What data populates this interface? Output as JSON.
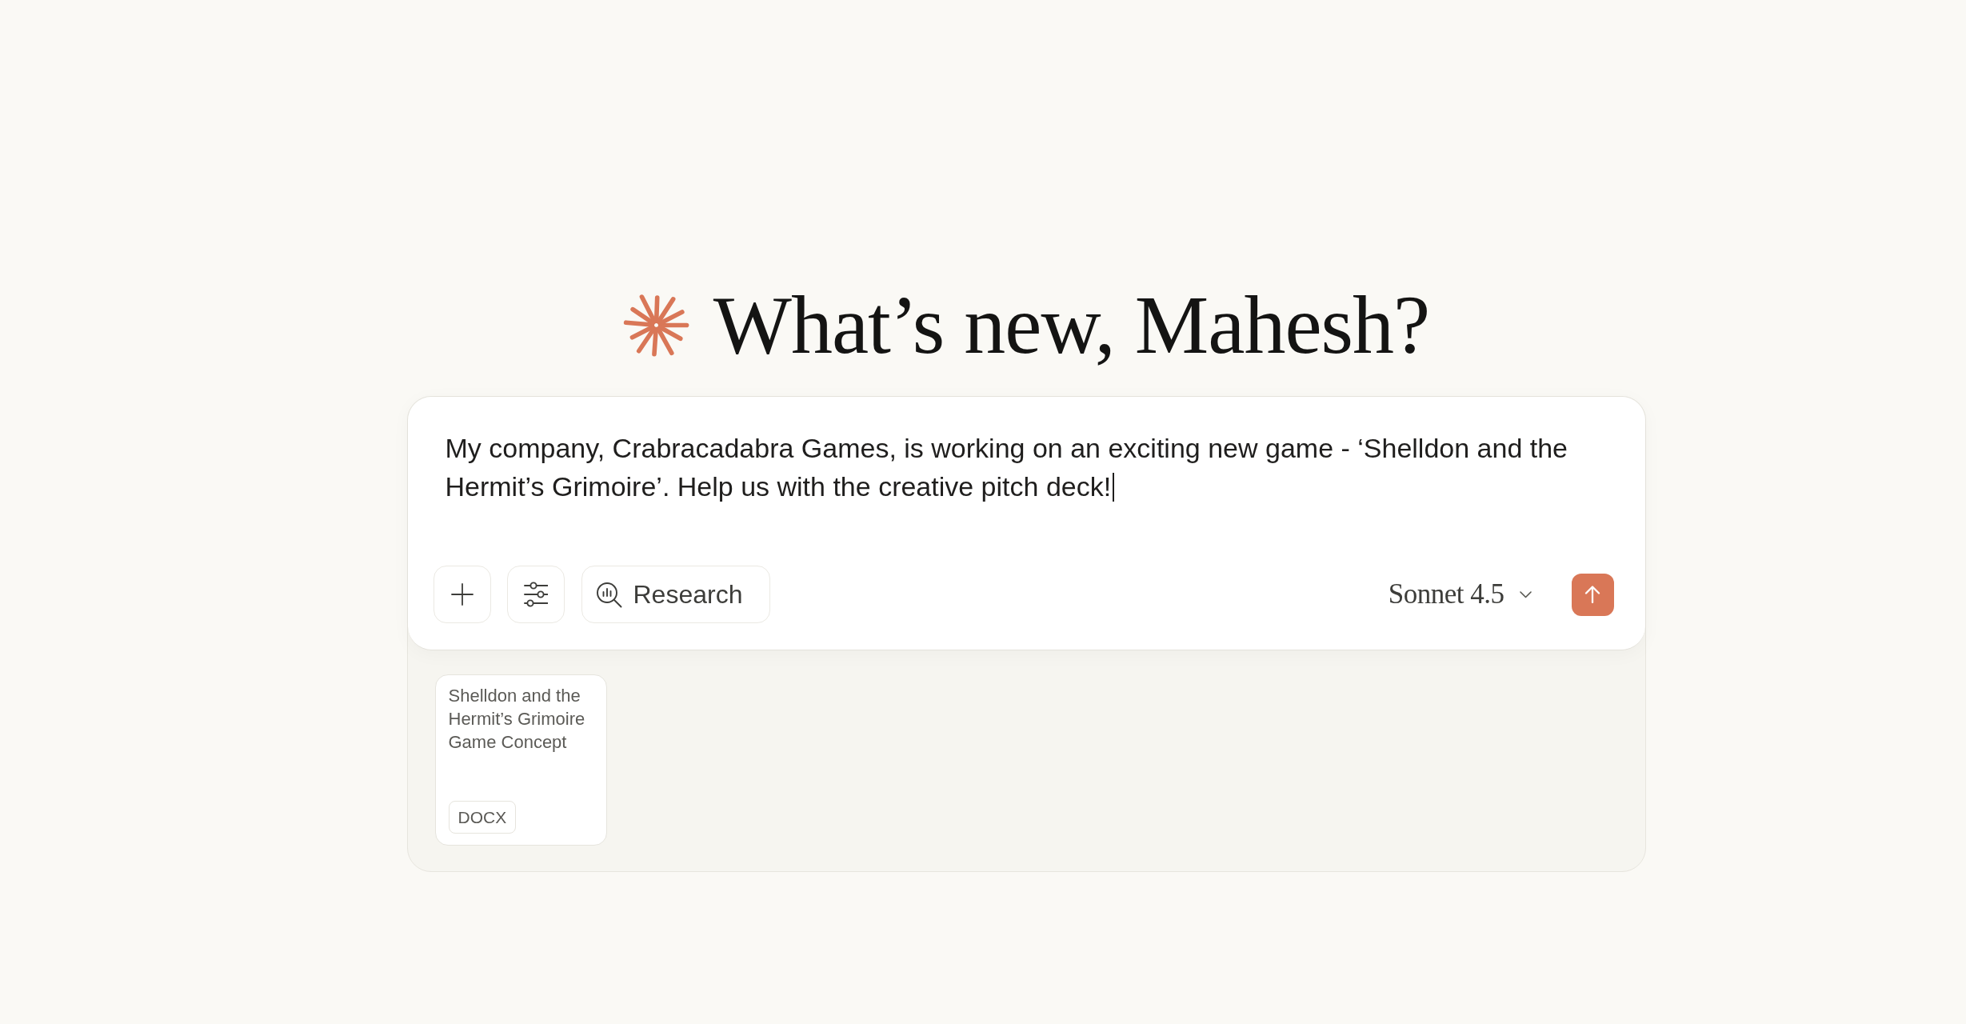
{
  "greeting": {
    "title": "What’s new, Mahesh?"
  },
  "composer": {
    "message": {
      "value": "My company, Crabracadabra Games, is working on an exciting new game - ‘Shelldon and the Hermit’s Grimoire’. Help us with the creative pitch deck!",
      "focused": true
    },
    "toolbar": {
      "research_button": {
        "label": "Research"
      },
      "model_selector": {
        "label": "Sonnet 4.5"
      }
    }
  },
  "attachments": [
    {
      "title": "Shelldon and the Hermit’s Grimoire Game Concept",
      "type": "DOCX"
    }
  ]
}
